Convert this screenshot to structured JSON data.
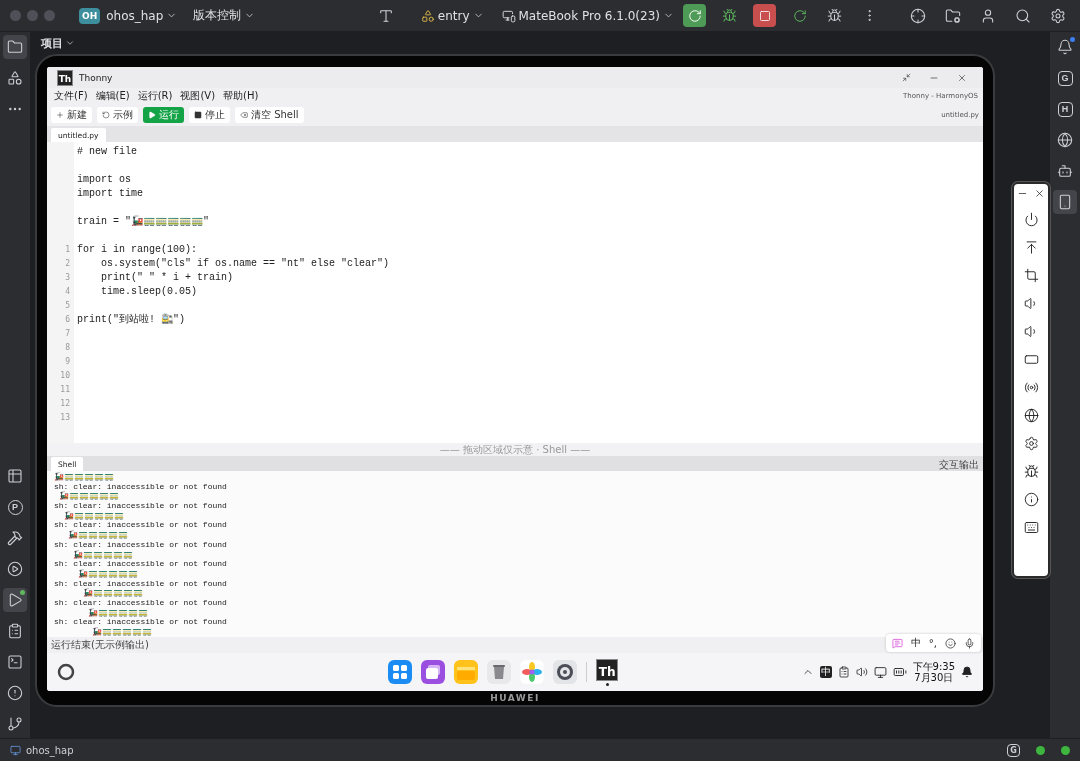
{
  "ide": {
    "project_badge": "OH",
    "project": "ohos_hap",
    "vcs": "版本控制",
    "run_config": "entry",
    "device": "MateBook Pro 6.1.0(23)",
    "panel_title": "项目",
    "left_rail_top": [
      {
        "selected": true
      },
      {
        "selected": false
      },
      {
        "selected": false
      }
    ],
    "left_rail_bottom": [
      {
        "selected": false
      },
      {
        "selected": false,
        "letter": "P"
      },
      {
        "selected": false
      },
      {
        "selected": false
      },
      {
        "selected": true
      },
      {
        "selected": false
      },
      {
        "selected": false
      },
      {
        "selected": false
      },
      {
        "selected": false
      }
    ],
    "right_rail": [
      {
        "selected": false
      },
      {
        "selected": false,
        "letter": "G"
      },
      {
        "selected": false,
        "letter": "H"
      },
      {
        "selected": false
      },
      {
        "selected": false
      },
      {
        "selected": true
      }
    ],
    "status_bar": {
      "project": "ohos_hap",
      "letter": "G"
    }
  },
  "device": {
    "brand": "HUAWEI"
  },
  "thonny": {
    "app_letters": "Th",
    "title": "Thonny",
    "menu": [
      "文件(F)",
      "编辑(E)",
      "运行(R)",
      "视图(V)",
      "帮助(H)"
    ],
    "caption": "Thonny - HarmonyOS",
    "toolbar": [
      {
        "kind": "new",
        "label": "新建"
      },
      {
        "kind": "examples",
        "label": "示例"
      },
      {
        "kind": "run",
        "label": "运行"
      },
      {
        "kind": "stop",
        "label": "停止"
      },
      {
        "kind": "clear",
        "label": "清空 Shell"
      }
    ],
    "file_name": "untitled.py",
    "tabs": [
      {
        "label": "untitled.py",
        "selected": true
      }
    ],
    "code": [
      {
        "kind": "code",
        "text": "# new file"
      },
      {
        "kind": "blank"
      },
      {
        "kind": "code",
        "text": "import os"
      },
      {
        "kind": "code",
        "text": "import time"
      },
      {
        "kind": "blank"
      },
      {
        "kind": "code",
        "text": "train = \"🚂🚃🚃🚃🚃🚃\""
      },
      {
        "kind": "blank"
      },
      {
        "kind": "code",
        "num": "1",
        "text": "for i in range(100):"
      },
      {
        "kind": "code",
        "num": "2",
        "text": "    os.system(\"cls\" if os.name == \"nt\" else \"clear\")"
      },
      {
        "kind": "code",
        "num": "3",
        "text": "    print(\" \" * i + train)"
      },
      {
        "kind": "code",
        "num": "4",
        "text": "    time.sleep(0.05)"
      },
      {
        "kind": "blank",
        "num": "5"
      },
      {
        "kind": "code",
        "num": "6",
        "text": "print(\"到站啦! 🚉\")"
      },
      {
        "kind": "blank",
        "num": "7"
      },
      {
        "kind": "blank",
        "num": "8"
      },
      {
        "kind": "blank",
        "num": "9"
      },
      {
        "kind": "blank",
        "num": "10"
      },
      {
        "kind": "blank",
        "num": "11"
      },
      {
        "kind": "blank",
        "num": "12"
      },
      {
        "kind": "blank",
        "num": "13"
      }
    ],
    "divider_label": "—— 拖动区域仅示意 · Shell ——",
    "shell_tabs": [
      {
        "label": "Shell",
        "selected": true
      }
    ],
    "shell_caption": "交互输出",
    "shell_lines": [
      "🚂🚃🚃🚃🚃🚃",
      "sh: clear: inaccessible or not found",
      " 🚂🚃🚃🚃🚃🚃",
      "sh: clear: inaccessible or not found",
      "  🚂🚃🚃🚃🚃🚃",
      "sh: clear: inaccessible or not found",
      "   🚂🚃🚃🚃🚃🚃",
      "sh: clear: inaccessible or not found",
      "    🚂🚃🚃🚃🚃🚃",
      "sh: clear: inaccessible or not found",
      "     🚂🚃🚃🚃🚃🚃",
      "sh: clear: inaccessible or not found",
      "      🚂🚃🚃🚃🚃🚃",
      "sh: clear: inaccessible or not found",
      "       🚂🚃🚃🚃🚃🚃",
      "sh: clear: inaccessible or not found",
      "        🚂🚃🚃🚃🚃🚃"
    ],
    "status": "运行结束(无示例输出)"
  },
  "ime": {
    "language": "中",
    "punctuation": "°,"
  },
  "taskbar": {
    "app_letters": "Th",
    "input_indicator": "中",
    "time": "下午9:35",
    "date": "7月30日"
  }
}
